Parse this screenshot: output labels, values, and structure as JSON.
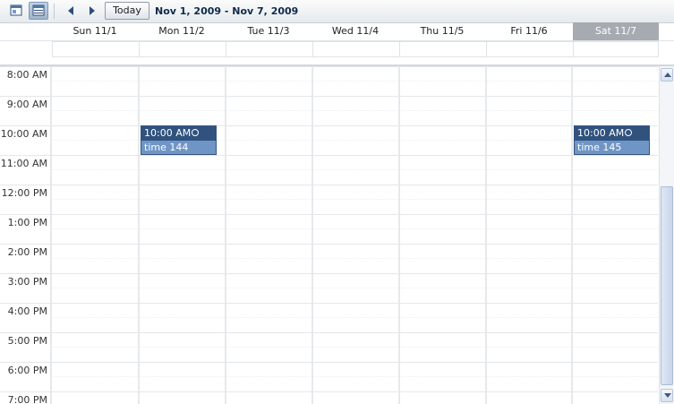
{
  "toolbar": {
    "view_buttons": [
      {
        "name": "day-view-button",
        "icon": "day-view-icon",
        "active": false
      },
      {
        "name": "week-view-button",
        "icon": "week-view-icon",
        "active": true
      }
    ],
    "prev_icon": "chevron-left-icon",
    "next_icon": "chevron-right-icon",
    "today_label": "Today",
    "range_title": "Nov 1, 2009 - Nov 7, 2009"
  },
  "days": [
    {
      "label": "Sun 11/1",
      "selected": false
    },
    {
      "label": "Mon 11/2",
      "selected": false
    },
    {
      "label": "Tue 11/3",
      "selected": false
    },
    {
      "label": "Wed 11/4",
      "selected": false
    },
    {
      "label": "Thu 11/5",
      "selected": false
    },
    {
      "label": "Fri 11/6",
      "selected": false
    },
    {
      "label": "Sat 11/7",
      "selected": true
    }
  ],
  "hours": [
    "8:00 AM",
    "9:00 AM",
    "10:00 AM",
    "11:00 AM",
    "12:00 PM",
    "1:00 PM",
    "2:00 PM",
    "3:00 PM",
    "4:00 PM",
    "5:00 PM",
    "6:00 PM",
    "7:00 PM"
  ],
  "events": [
    {
      "day": "Mon 11/2",
      "time": "10:00 AM",
      "title": "time 144",
      "icon": "alarm-clock-icon"
    },
    {
      "day": "Sat 11/7",
      "time": "10:00 AM",
      "title": "time 145",
      "icon": "alarm-clock-icon"
    }
  ],
  "colors": {
    "event_header": "#30527d",
    "event_body": "#6f95c6",
    "selected_day": "#a6abb2",
    "title_text": "#0f2a4a"
  }
}
